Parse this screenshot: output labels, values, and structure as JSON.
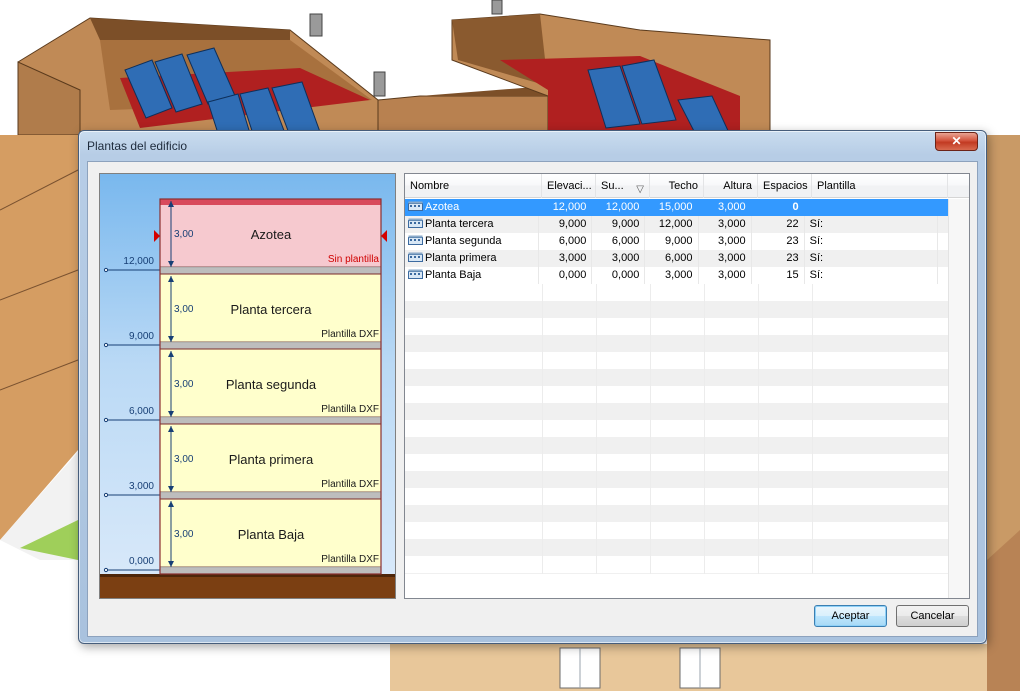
{
  "dialog": {
    "title": "Plantas del edificio",
    "close_glyph": "✕",
    "close_icon": "close-icon"
  },
  "diagram": {
    "floors": [
      {
        "name": "Azotea",
        "height": "3,00",
        "template": "Sin plantilla",
        "template_color": "#d00000",
        "fill": "#f6c9cf",
        "level": "12,000"
      },
      {
        "name": "Planta tercera",
        "height": "3,00",
        "template": "Plantilla DXF",
        "template_color": "#1a1a1a",
        "fill": "#ffffcc",
        "level": "9,000"
      },
      {
        "name": "Planta segunda",
        "height": "3,00",
        "template": "Plantilla DXF",
        "template_color": "#1a1a1a",
        "fill": "#ffffcc",
        "level": "6,000"
      },
      {
        "name": "Planta primera",
        "height": "3,00",
        "template": "Plantilla DXF",
        "template_color": "#1a1a1a",
        "fill": "#ffffcc",
        "level": "3,000"
      },
      {
        "name": "Planta Baja",
        "height": "3,00",
        "template": "Plantilla DXF",
        "template_color": "#1a1a1a",
        "fill": "#ffffcc",
        "level": "0,000"
      }
    ],
    "selection_marker_color": "#d40000",
    "ground_color": "#7b3f12"
  },
  "table": {
    "columns": [
      "Nombre",
      "Elevaci...",
      "Su...",
      "Techo",
      "Altura",
      "Espacios",
      "Plantilla"
    ],
    "sort_icon": "sort-descending-icon",
    "rows": [
      {
        "nombre": "Azotea",
        "elevacion": "12,000",
        "suelo": "12,000",
        "techo": "15,000",
        "altura": "3,000",
        "espacios": "0",
        "plantilla": "",
        "selected": true
      },
      {
        "nombre": "Planta tercera",
        "elevacion": "9,000",
        "suelo": "9,000",
        "techo": "12,000",
        "altura": "3,000",
        "espacios": "22",
        "plantilla": "Sí:",
        "selected": false
      },
      {
        "nombre": "Planta segunda",
        "elevacion": "6,000",
        "suelo": "6,000",
        "techo": "9,000",
        "altura": "3,000",
        "espacios": "23",
        "plantilla": "Sí:",
        "selected": false
      },
      {
        "nombre": "Planta primera",
        "elevacion": "3,000",
        "suelo": "3,000",
        "techo": "6,000",
        "altura": "3,000",
        "espacios": "23",
        "plantilla": "Sí:",
        "selected": false
      },
      {
        "nombre": "Planta Baja",
        "elevacion": "0,000",
        "suelo": "0,000",
        "techo": "3,000",
        "altura": "3,000",
        "espacios": "15",
        "plantilla": "Sí:",
        "selected": false
      }
    ],
    "selection_color": "#3399ff"
  },
  "buttons": {
    "ok": "Aceptar",
    "cancel": "Cancelar"
  }
}
